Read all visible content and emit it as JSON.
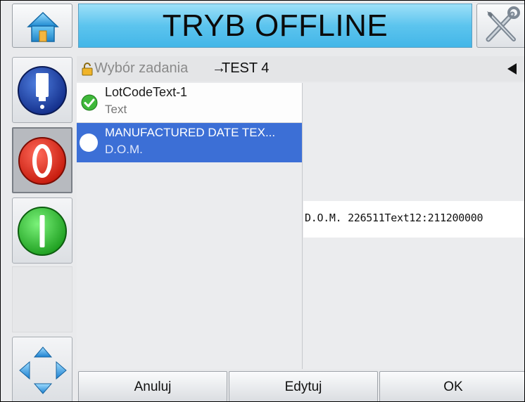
{
  "header": {
    "title": "TRYB OFFLINE",
    "title_bg_color": "#5cc4ee",
    "icons": {
      "home": "home-icon",
      "status": "usb-icon",
      "tools": "tools-icon"
    }
  },
  "sidebar": {
    "items": [
      {
        "icon": "ink-cartridge-icon",
        "state": "normal"
      },
      {
        "icon": "stop-icon",
        "state": "pressed"
      },
      {
        "icon": "start-icon",
        "state": "normal"
      },
      {
        "icon": "empty-slot",
        "state": "disabled"
      },
      {
        "icon": "navigation-arrows-icon",
        "state": "normal"
      }
    ]
  },
  "breadcrumb": {
    "parent": "Wybór zadania",
    "separator": "→",
    "current": "TEST 4"
  },
  "list": {
    "items": [
      {
        "title": "LotCodeText-1",
        "subtitle": "Text",
        "status": "checked"
      },
      {
        "title": "MANUFACTURED DATE TEX...",
        "subtitle": "D.O.M.",
        "status": "selected"
      }
    ],
    "selected_color": "#3c6fd6"
  },
  "preview": {
    "text": "D.O.M. 226511Text12:211200000"
  },
  "footer": {
    "cancel_label": "Anuluj",
    "edit_label": "Edytuj",
    "ok_label": "OK"
  }
}
